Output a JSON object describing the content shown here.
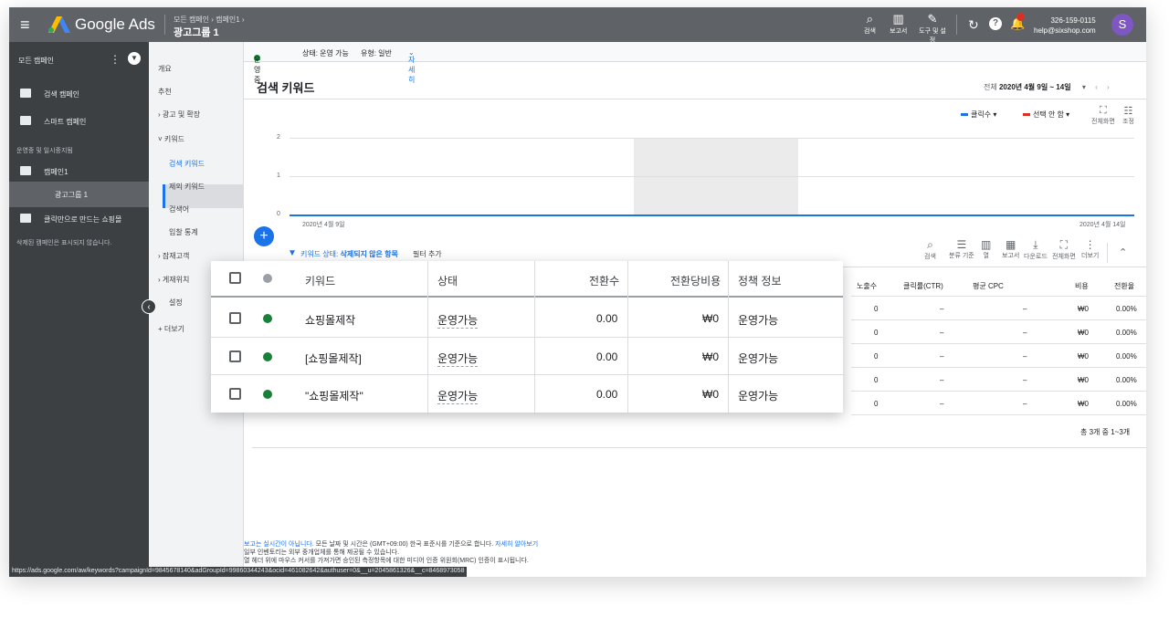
{
  "topbar": {
    "product": "Google Ads",
    "breadcrumb_path": "모든 캠페인 › 캠페인1 ›",
    "current": "광고그룹 1",
    "tools": [
      {
        "label": "검색",
        "icon": "search-icon"
      },
      {
        "label": "보고서",
        "icon": "reports-icon"
      },
      {
        "label": "도구 및 설정",
        "icon": "wrench-icon"
      }
    ],
    "account_id": "326-159-0115",
    "account_email": "help@sixshop.com",
    "avatar_letter": "S"
  },
  "sidebar": {
    "header": "모든 캠페인",
    "items": [
      {
        "label": "검색 캠페인"
      },
      {
        "label": "스마트 캠페인"
      }
    ],
    "section": "운영중 및 일시중지됨",
    "campaign": "캠페인1",
    "adgroup": "광고그룹 1",
    "shopping": "클릭만으로 만드는 쇼핑몰",
    "note": "삭제된 캠페인은 표시되지 않습니다."
  },
  "nav": {
    "items": [
      "개요",
      "추천",
      "광고 및 확장",
      "키워드",
      "검색 키워드",
      "제외 키워드",
      "검색어",
      "입찰 통계",
      "잠재고객",
      "게재위치",
      "설정"
    ],
    "more": "더보기"
  },
  "status": {
    "state": "운영중",
    "detail1": "상태: 운영 가능",
    "detail2": "유형: 일반",
    "more": "자세히"
  },
  "main": {
    "title": "검색 키워드",
    "range_label": "전체",
    "range_value": "2020년 4월 9일 ~ 14일",
    "legend1": "클릭수",
    "legend2": "선택 안 함",
    "fullscreen": "전체화면",
    "adjust": "조정",
    "chart_y2": "2",
    "chart_y1": "1",
    "chart_y0": "0",
    "chart_start": "2020년 4월 9일",
    "chart_end": "2020년 4월 14일",
    "filter_label": "키워드 상태:",
    "filter_value": "삭제되지 않은 항목",
    "filter_add": "필터 추가",
    "toolbar": [
      "검색",
      "분류 기준",
      "열",
      "보고서",
      "다운로드",
      "전체화면",
      "더보기"
    ]
  },
  "bg_table": {
    "headers": [
      "노출수",
      "클릭률(CTR)",
      "평균 CPC",
      "비용",
      "전환율"
    ],
    "rows": [
      [
        "0",
        "–",
        "–",
        "₩0",
        "0.00%"
      ],
      [
        "0",
        "–",
        "–",
        "₩0",
        "0.00%"
      ],
      [
        "0",
        "–",
        "–",
        "₩0",
        "0.00%"
      ],
      [
        "0",
        "–",
        "–",
        "₩0",
        "0.00%"
      ],
      [
        "0",
        "–",
        "–",
        "₩0",
        "0.00%"
      ]
    ],
    "total": "총 3개 중 1~3개"
  },
  "popup": {
    "headers": [
      "키워드",
      "상태",
      "전환수",
      "전환당비용",
      "정책 정보"
    ],
    "rows": [
      [
        "쇼핑몰제작",
        "운영가능",
        "0.00",
        "₩0",
        "운영가능"
      ],
      [
        "[쇼핑몰제작]",
        "운영가능",
        "0.00",
        "₩0",
        "운영가능"
      ],
      [
        "\"쇼핑몰제작\"",
        "운영가능",
        "0.00",
        "₩0",
        "운영가능"
      ]
    ]
  },
  "footer": {
    "line1_link": "보고는 실시간이 아닙니다.",
    "line1": "모든 날짜 및 시간은 (GMT+09:00) 한국 표준시를 기준으로 합니다.",
    "line1_more": "자세히 알아보기",
    "line2": "일부 인벤토리는 외부 중개업체를 통해 제공될 수 있습니다.",
    "line3": "열 헤더 위에 마우스 커서를 가져가면 승인된 측정항목에 대한 미디어 인증 위원회(MRC) 인증이 표시됩니다."
  },
  "url": "https://ads.google.com/aw/keywords?campaignId=9845678140&adGroupId=99860344243&ocid=461082642&authuser=0&__u=2045861326&__c=8468973058"
}
